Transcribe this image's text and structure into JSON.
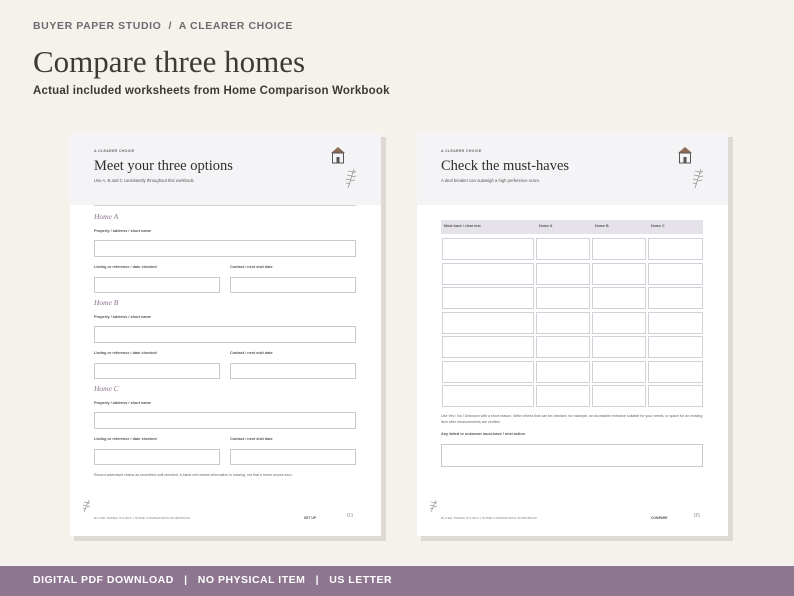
{
  "header": {
    "brand": "BUYER PAPER STUDIO",
    "separator": "/",
    "tagline": "A CLEARER CHOICE",
    "title": "Compare three homes",
    "subtitle": "Actual included worksheets from Home Comparison Workbook"
  },
  "footer_bar": {
    "text": "DIGITAL PDF DOWNLOAD   |   NO PHYSICAL ITEM   |   US LETTER"
  },
  "left_page": {
    "kicker": "A CLEARER CHOICE",
    "title": "Meet your three options",
    "subtitle": "Use A, B and C consistently throughout this workbook.",
    "sections": [
      {
        "title": "Home A",
        "label_full": "Property / address / short name",
        "label_left": "Listing or reference / date checked",
        "label_right": "Contact / next visit date"
      },
      {
        "title": "Home B",
        "label_full": "Property / address / short name",
        "label_left": "Listing or reference / date checked",
        "label_right": "Contact / next visit date"
      },
      {
        "title": "Home C",
        "label_full": "Property / address / short name",
        "label_left": "Listing or reference / date checked",
        "label_right": "Contact / next visit date"
      }
    ],
    "note": "Record advertised claims as unverified until checked. A blank cell means information is missing, not that a home scores zero.",
    "footer_left": "BUYER PAPER STUDIO  |  HOME COMPARISON WORKBOOK",
    "footer_mid": "SET UP",
    "page_number": "03"
  },
  "right_page": {
    "kicker": "A CLEARER CHOICE",
    "title": "Check the must-haves",
    "subtitle": "A deal breaker can outweigh a high preference score.",
    "columns": [
      "Must-have / clear test",
      "Home A",
      "Home B",
      "Home C"
    ],
    "row_count": 7,
    "instructions": "Use Yes / No / Unknown with a short reason. Write criteria that can be checked: for example, an accessible entrance suitable for your needs, or space for an existing item after measurements are verified.",
    "followup_label": "Any failed or unknown must-have / next action",
    "footer_left": "BUYER PAPER STUDIO  |  HOME COMPARISON WORKBOOK",
    "footer_mid": "COMPARE",
    "page_number": "05"
  },
  "colors": {
    "accent": "#8e7590",
    "background": "#f5f2ec",
    "table_header": "#e5e2ea"
  },
  "icons": [
    "house-icon",
    "sprig-icon"
  ]
}
